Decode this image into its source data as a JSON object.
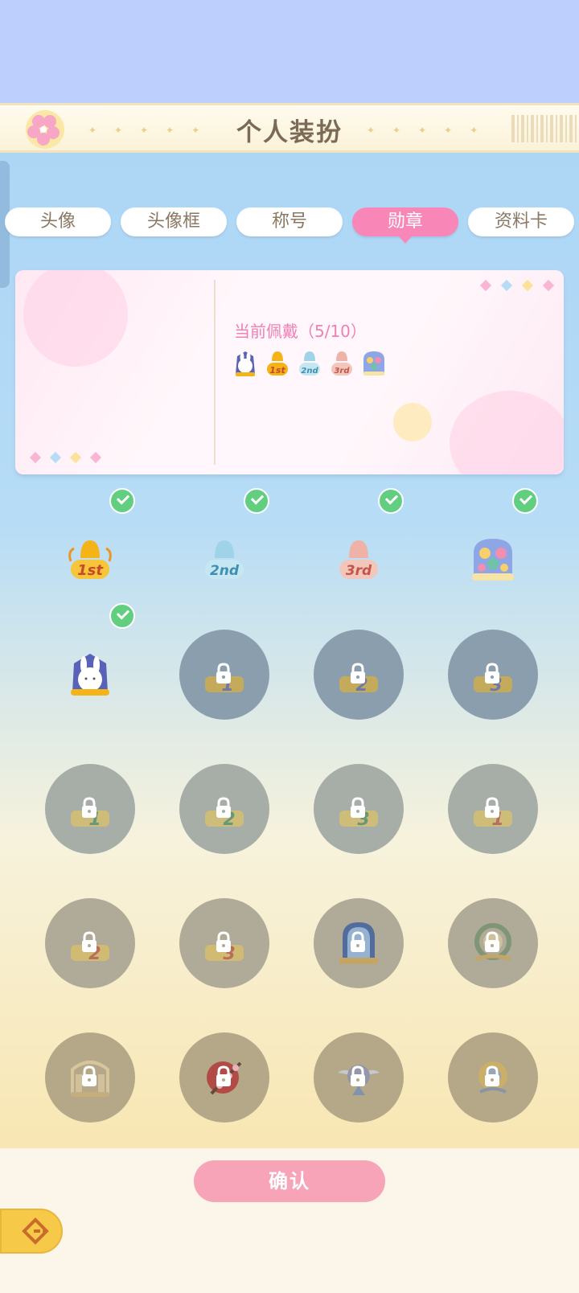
{
  "header": {
    "title": "个人装扮"
  },
  "tabs": [
    {
      "label": "头像",
      "active": false
    },
    {
      "label": "头像框",
      "active": false
    },
    {
      "label": "称号",
      "active": false
    },
    {
      "label": "勋章",
      "active": true
    },
    {
      "label": "资料卡",
      "active": false
    }
  ],
  "wearing": {
    "label": "当前佩戴（5/10）",
    "badges": [
      "bunny-medal",
      "1st-medal",
      "2nd-medal",
      "3rd-medal",
      "flower-window-medal"
    ]
  },
  "medals": [
    {
      "icon": "1st-medal",
      "text": "1st",
      "color": "#f4b418",
      "equipped": true,
      "locked": false
    },
    {
      "icon": "2nd-medal",
      "text": "2nd",
      "color": "#7cc3dd",
      "equipped": true,
      "locked": false
    },
    {
      "icon": "3rd-medal",
      "text": "3rd",
      "color": "#e69c8f",
      "equipped": true,
      "locked": false
    },
    {
      "icon": "flower-window-medal",
      "text": "",
      "color": "#8fa6e6",
      "equipped": true,
      "locked": false
    },
    {
      "icon": "bunny-medal",
      "text": "",
      "color": "#5862b8",
      "equipped": true,
      "locked": false
    },
    {
      "icon": "rank-1-medal-a",
      "text": "1",
      "color": "#5c5ca8",
      "equipped": false,
      "locked": true
    },
    {
      "icon": "rank-2-medal-a",
      "text": "2",
      "color": "#5c5ca8",
      "equipped": false,
      "locked": true
    },
    {
      "icon": "rank-3-medal-a",
      "text": "3",
      "color": "#5c5ca8",
      "equipped": false,
      "locked": true
    },
    {
      "icon": "rank-1-medal-b",
      "text": "1",
      "color": "#3f8a57",
      "equipped": false,
      "locked": true
    },
    {
      "icon": "rank-2-medal-b",
      "text": "2",
      "color": "#3f8a57",
      "equipped": false,
      "locked": true
    },
    {
      "icon": "rank-3-medal-b",
      "text": "3",
      "color": "#3f8a57",
      "equipped": false,
      "locked": true
    },
    {
      "icon": "rank-1-medal-c",
      "text": "1",
      "color": "#c24535",
      "equipped": false,
      "locked": true
    },
    {
      "icon": "rank-2-medal-c",
      "text": "2",
      "color": "#c24535",
      "equipped": false,
      "locked": true
    },
    {
      "icon": "rank-3-medal-c",
      "text": "3",
      "color": "#c24535",
      "equipped": false,
      "locked": true
    },
    {
      "icon": "arch-window-medal",
      "text": "",
      "color": "#3b5e9c",
      "equipped": false,
      "locked": true
    },
    {
      "icon": "wreath-medal",
      "text": "",
      "color": "#6f8f6a",
      "equipped": false,
      "locked": true
    },
    {
      "icon": "gate-medal",
      "text": "",
      "color": "#c9b07a",
      "equipped": false,
      "locked": true
    },
    {
      "icon": "blossom-branch-medal",
      "text": "",
      "color": "#b23b3b",
      "equipped": false,
      "locked": true
    },
    {
      "icon": "winged-crest-medal",
      "text": "",
      "color": "#8b90b5",
      "equipped": false,
      "locked": true
    },
    {
      "icon": "sun-crest-medal",
      "text": "",
      "color": "#d3b05e",
      "equipped": false,
      "locked": true
    }
  ],
  "actions": {
    "confirm_label": "确认",
    "back_icon": "back-arrow-icon"
  },
  "colors": {
    "accent": "#f887b8",
    "confirm": "#f7a4b9",
    "check": "#62cf80"
  }
}
